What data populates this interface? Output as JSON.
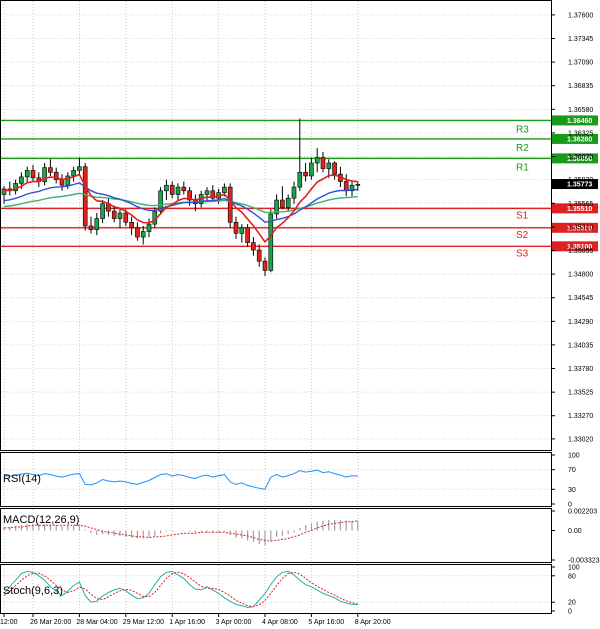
{
  "chart_data": {
    "type": "candlestick",
    "main": {
      "price_ticks": [
        "1.37600",
        "1.37345",
        "1.37090",
        "1.36835",
        "1.36580",
        "1.36325",
        "1.36070",
        "1.35820",
        "1.35565",
        "1.35310",
        "1.35055",
        "1.34800",
        "1.34545",
        "1.34290",
        "1.34035",
        "1.33780",
        "1.33525",
        "1.33270",
        "1.33020"
      ],
      "ylim": [
        1.329,
        1.3775
      ],
      "current_price": "1.35773",
      "levels": [
        {
          "name": "R3",
          "value": 1.3646,
          "label": "1.36460",
          "color": "#1a9a1a"
        },
        {
          "name": "R2",
          "value": 1.3626,
          "label": "1.36260",
          "color": "#1a9a1a"
        },
        {
          "name": "R1",
          "value": 1.3605,
          "label": "1.36050",
          "color": "#1a9a1a"
        },
        {
          "name": "S1",
          "value": 1.3551,
          "label": "1.35510",
          "color": "#e02020"
        },
        {
          "name": "S2",
          "value": 1.353,
          "label": "1.35300",
          "color": "#e02020"
        },
        {
          "name": "S3",
          "value": 1.351,
          "label": "1.35100",
          "color": "#e02020"
        }
      ],
      "candles": [
        [
          1.3566,
          1.3575,
          1.3556,
          1.3572
        ],
        [
          1.3572,
          1.358,
          1.3565,
          1.357
        ],
        [
          1.357,
          1.3582,
          1.3566,
          1.3578
        ],
        [
          1.3578,
          1.359,
          1.3572,
          1.3585
        ],
        [
          1.3585,
          1.3596,
          1.3578,
          1.3592
        ],
        [
          1.3592,
          1.3598,
          1.358,
          1.3584
        ],
        [
          1.3584,
          1.359,
          1.3574,
          1.358
        ],
        [
          1.358,
          1.36,
          1.3576,
          1.3595
        ],
        [
          1.3595,
          1.3604,
          1.3586,
          1.359
        ],
        [
          1.359,
          1.3595,
          1.3578,
          1.3582
        ],
        [
          1.3582,
          1.3588,
          1.357,
          1.3576
        ],
        [
          1.3576,
          1.359,
          1.3572,
          1.3586
        ],
        [
          1.3586,
          1.3596,
          1.358,
          1.3592
        ],
        [
          1.3592,
          1.3606,
          1.3586,
          1.3596
        ],
        [
          1.3596,
          1.36,
          1.3527,
          1.3532
        ],
        [
          1.3532,
          1.3542,
          1.3524,
          1.3528
        ],
        [
          1.3528,
          1.3546,
          1.3522,
          1.354
        ],
        [
          1.354,
          1.356,
          1.3535,
          1.3556
        ],
        [
          1.3556,
          1.3562,
          1.3542,
          1.3548
        ],
        [
          1.3548,
          1.3554,
          1.3536,
          1.354
        ],
        [
          1.354,
          1.3552,
          1.353,
          1.3546
        ],
        [
          1.3546,
          1.355,
          1.3532,
          1.3536
        ],
        [
          1.3536,
          1.3542,
          1.3522,
          1.353
        ],
        [
          1.353,
          1.3536,
          1.3516,
          1.352
        ],
        [
          1.352,
          1.3532,
          1.3512,
          1.3526
        ],
        [
          1.3526,
          1.354,
          1.352,
          1.3534
        ],
        [
          1.3534,
          1.3552,
          1.353,
          1.3548
        ],
        [
          1.3548,
          1.3574,
          1.3545,
          1.357
        ],
        [
          1.357,
          1.3582,
          1.356,
          1.3576
        ],
        [
          1.3576,
          1.358,
          1.3562,
          1.3566
        ],
        [
          1.3566,
          1.3578,
          1.356,
          1.3574
        ],
        [
          1.3574,
          1.358,
          1.3566,
          1.357
        ],
        [
          1.357,
          1.3574,
          1.3554,
          1.356
        ],
        [
          1.356,
          1.3566,
          1.3548,
          1.3556
        ],
        [
          1.3556,
          1.357,
          1.3552,
          1.3566
        ],
        [
          1.3566,
          1.3574,
          1.356,
          1.357
        ],
        [
          1.357,
          1.3576,
          1.3558,
          1.3562
        ],
        [
          1.3562,
          1.3572,
          1.3556,
          1.3568
        ],
        [
          1.3568,
          1.3578,
          1.3564,
          1.3574
        ],
        [
          1.3574,
          1.3578,
          1.353,
          1.3536
        ],
        [
          1.3536,
          1.3542,
          1.3518,
          1.3524
        ],
        [
          1.3524,
          1.3534,
          1.3514,
          1.353
        ],
        [
          1.353,
          1.3534,
          1.351,
          1.3514
        ],
        [
          1.3514,
          1.352,
          1.35,
          1.3506
        ],
        [
          1.3506,
          1.3512,
          1.3488,
          1.3494
        ],
        [
          1.3494,
          1.3498,
          1.3478,
          1.3484
        ],
        [
          1.3484,
          1.355,
          1.3482,
          1.3545
        ],
        [
          1.3545,
          1.3566,
          1.354,
          1.356
        ],
        [
          1.356,
          1.3575,
          1.355,
          1.3552
        ],
        [
          1.3552,
          1.3566,
          1.3548,
          1.3562
        ],
        [
          1.3562,
          1.358,
          1.3556,
          1.3574
        ],
        [
          1.3574,
          1.3648,
          1.357,
          1.359
        ],
        [
          1.359,
          1.36,
          1.358,
          1.3586
        ],
        [
          1.3586,
          1.3606,
          1.3582,
          1.36
        ],
        [
          1.36,
          1.3616,
          1.359,
          1.3606
        ],
        [
          1.3606,
          1.3612,
          1.359,
          1.3594
        ],
        [
          1.3594,
          1.3604,
          1.3584,
          1.36
        ],
        [
          1.36,
          1.3602,
          1.3582,
          1.3588
        ],
        [
          1.3588,
          1.3596,
          1.3574,
          1.358
        ],
        [
          1.358,
          1.3588,
          1.3564,
          1.357
        ],
        [
          1.357,
          1.358,
          1.3564,
          1.3576
        ],
        [
          1.3576,
          1.358,
          1.357,
          1.3577
        ]
      ]
    },
    "x_ticks": [
      {
        "label": "12:00",
        "index": 0
      },
      {
        "label": "26 Mar 20:00",
        "index": 5
      },
      {
        "label": "28 Mar 04:00",
        "index": 13
      },
      {
        "label": "29 Mar 12:00",
        "index": 21
      },
      {
        "label": "1 Apr 16:00",
        "index": 29
      },
      {
        "label": "3 Apr 00:00",
        "index": 37
      },
      {
        "label": "4 Apr 08:00",
        "index": 45
      },
      {
        "label": "5 Apr 16:00",
        "index": 53
      },
      {
        "label": "8 Apr 20:00",
        "index": 61
      }
    ],
    "rsi": {
      "title": "RSI(14)",
      "ticks": [
        "100",
        "70",
        "30",
        "0"
      ],
      "ylim": [
        0,
        100
      ],
      "color": "#1e90ff",
      "values": [
        58,
        57,
        59,
        61,
        63,
        60,
        58,
        62,
        60,
        57,
        55,
        58,
        61,
        62,
        40,
        39,
        43,
        50,
        47,
        45,
        47,
        45,
        42,
        40,
        44,
        48,
        54,
        60,
        62,
        57,
        60,
        58,
        54,
        52,
        57,
        59,
        55,
        58,
        60,
        45,
        40,
        43,
        38,
        35,
        32,
        30,
        55,
        60,
        55,
        58,
        62,
        68,
        65,
        67,
        69,
        64,
        66,
        62,
        59,
        55,
        58,
        57
      ]
    },
    "macd": {
      "title": "MACD(12,26,9)",
      "ticks": [
        "0.002203",
        "0.00",
        "-0.003323"
      ],
      "ylim": [
        -0.003323,
        0.002203
      ],
      "hist_color": "#a0a0a0",
      "signal_color": "#e02020",
      "histogram": [
        0.0004,
        0.0004,
        0.0005,
        0.0006,
        0.0007,
        0.0007,
        0.0006,
        0.0007,
        0.0007,
        0.0006,
        0.0005,
        0.0005,
        0.0006,
        0.0006,
        0.0001,
        -0.0003,
        -0.0005,
        -0.0004,
        -0.0005,
        -0.0006,
        -0.0006,
        -0.0007,
        -0.0008,
        -0.0009,
        -0.0009,
        -0.0008,
        -0.0006,
        -0.0003,
        -0.0001,
        -0.0001,
        0.0,
        0.0,
        -0.0001,
        -0.0002,
        -0.0002,
        -0.0002,
        -0.0002,
        -0.0002,
        -0.0001,
        -0.0005,
        -0.0008,
        -0.0009,
        -0.0011,
        -0.0013,
        -0.0015,
        -0.0017,
        -0.0012,
        -0.0007,
        -0.0006,
        -0.0004,
        -0.0002,
        0.0003,
        0.0006,
        0.0008,
        0.001,
        0.0011,
        0.0012,
        0.0012,
        0.0012,
        0.0011,
        0.0011,
        0.0011
      ],
      "signal": [
        0.0003,
        0.0003,
        0.0004,
        0.0004,
        0.0005,
        0.0006,
        0.0006,
        0.0006,
        0.0006,
        0.0006,
        0.0006,
        0.0006,
        0.0006,
        0.0006,
        0.0005,
        0.0003,
        0.0001,
        -0.0001,
        -0.0002,
        -0.0003,
        -0.0004,
        -0.0005,
        -0.0006,
        -0.0007,
        -0.0007,
        -0.0008,
        -0.0007,
        -0.0007,
        -0.0006,
        -0.0005,
        -0.0004,
        -0.0003,
        -0.0003,
        -0.0003,
        -0.0002,
        -0.0002,
        -0.0002,
        -0.0002,
        -0.0002,
        -0.0003,
        -0.0004,
        -0.0005,
        -0.0006,
        -0.0008,
        -0.001,
        -0.0011,
        -0.0012,
        -0.0011,
        -0.001,
        -0.0009,
        -0.0007,
        -0.0005,
        -0.0002,
        0.0,
        0.0003,
        0.0005,
        0.0007,
        0.0008,
        0.0009,
        0.001,
        0.001,
        0.0011
      ]
    },
    "stoch": {
      "title": "Stoch(9,6,3)",
      "ticks": [
        "100",
        "80",
        "20",
        "0"
      ],
      "ylim": [
        0,
        100
      ],
      "main_color": "#20b2aa",
      "signal_color": "#e02020",
      "main": [
        40,
        55,
        70,
        85,
        90,
        88,
        80,
        70,
        55,
        45,
        35,
        45,
        58,
        66,
        35,
        20,
        22,
        34,
        42,
        48,
        52,
        46,
        36,
        28,
        30,
        40,
        60,
        78,
        88,
        90,
        82,
        74,
        60,
        50,
        48,
        55,
        48,
        40,
        30,
        22,
        15,
        12,
        8,
        10,
        25,
        40,
        60,
        78,
        88,
        90,
        82,
        70,
        60,
        55,
        48,
        40,
        35,
        30,
        22,
        18,
        15,
        15
      ],
      "signal": [
        35,
        45,
        58,
        70,
        80,
        86,
        86,
        80,
        70,
        58,
        48,
        42,
        46,
        54,
        50,
        38,
        28,
        26,
        32,
        40,
        46,
        49,
        47,
        40,
        33,
        33,
        42,
        58,
        74,
        85,
        88,
        85,
        76,
        66,
        56,
        52,
        51,
        49,
        42,
        34,
        24,
        18,
        12,
        10,
        14,
        24,
        40,
        58,
        74,
        85,
        88,
        84,
        74,
        64,
        56,
        49,
        42,
        36,
        29,
        23,
        19,
        16
      ]
    }
  }
}
